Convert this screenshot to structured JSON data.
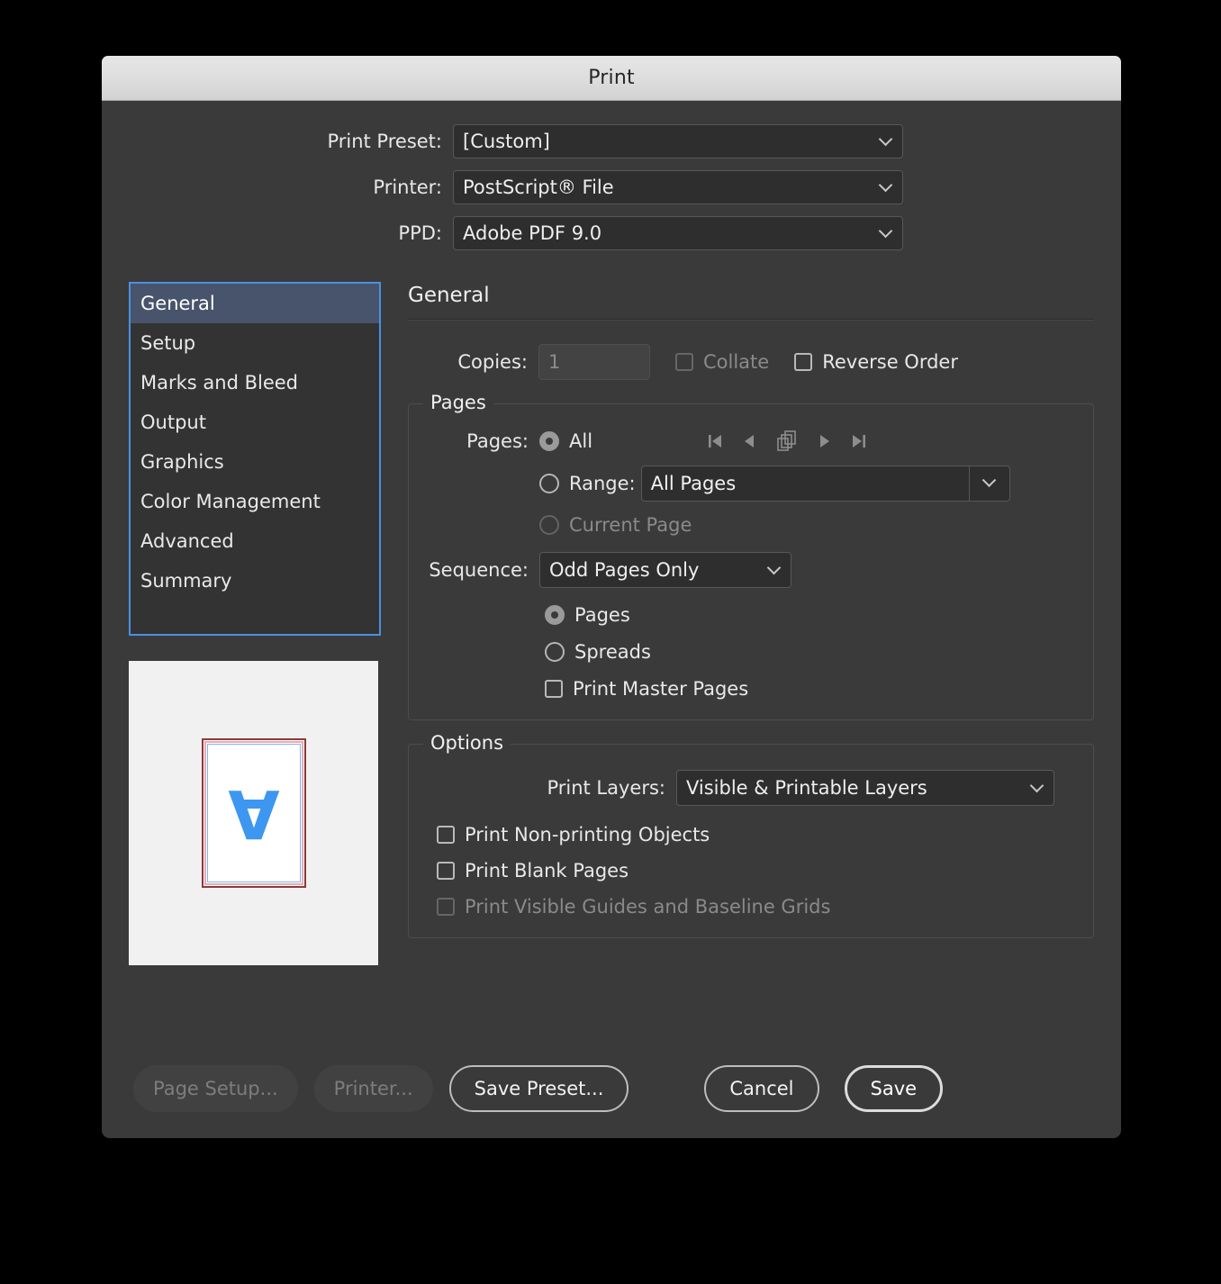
{
  "window": {
    "title": "Print"
  },
  "top_fields": [
    {
      "label": "Print Preset:",
      "value": "[Custom]",
      "name": "print-preset"
    },
    {
      "label": "Printer:",
      "value": "PostScript® File",
      "name": "printer"
    },
    {
      "label": "PPD:",
      "value": "Adobe PDF 9.0",
      "name": "ppd"
    }
  ],
  "sidebar": {
    "items": [
      {
        "label": "General",
        "selected": true
      },
      {
        "label": "Setup",
        "selected": false
      },
      {
        "label": "Marks and Bleed",
        "selected": false
      },
      {
        "label": "Output",
        "selected": false
      },
      {
        "label": "Graphics",
        "selected": false
      },
      {
        "label": "Color Management",
        "selected": false
      },
      {
        "label": "Advanced",
        "selected": false
      },
      {
        "label": "Summary",
        "selected": false
      }
    ]
  },
  "preview": {
    "glyph": "A",
    "page_color": "#ffffff",
    "bleed_color": "#f0a8b0",
    "trim_color": "#8b3a3a",
    "margin_color": "#7ab8f5",
    "art_color": "#3d97f0",
    "background_color": "#f1f1f1"
  },
  "main": {
    "section_title": "General",
    "copies": {
      "label": "Copies:",
      "value": "1",
      "collate_label": "Collate",
      "collate_checked": false,
      "reverse_order_label": "Reverse Order",
      "reverse_order_checked": false
    },
    "pages_group": {
      "legend": "Pages",
      "pages_label": "Pages:",
      "all_label": "All",
      "all_selected": true,
      "range_label": "Range:",
      "range_value": "All Pages",
      "range_selected": false,
      "current_page_label": "Current Page",
      "current_page_selected": false,
      "sequence_label": "Sequence:",
      "sequence_value": "Odd Pages Only",
      "pages_radio_label": "Pages",
      "pages_radio_selected": true,
      "spreads_label": "Spreads",
      "spreads_selected": false,
      "print_master_pages_label": "Print Master Pages",
      "print_master_pages_checked": false,
      "nav_icons": [
        "first-page-icon",
        "previous-page-icon",
        "pages-stack-icon",
        "next-page-icon",
        "last-page-icon"
      ]
    },
    "options_group": {
      "legend": "Options",
      "print_layers_label": "Print Layers:",
      "print_layers_value": "Visible & Printable Layers",
      "print_non_printing_label": "Print Non-printing Objects",
      "print_non_printing_checked": false,
      "print_blank_pages_label": "Print Blank Pages",
      "print_blank_pages_checked": false,
      "print_guides_label": "Print Visible Guides and Baseline Grids",
      "print_guides_checked": false
    }
  },
  "footer": {
    "page_setup": "Page Setup...",
    "printer": "Printer...",
    "save_preset": "Save Preset...",
    "cancel": "Cancel",
    "save": "Save"
  },
  "colors": {
    "accent_focus": "#4a90e2",
    "selection": "#47546b",
    "dialog_bg": "#3a3a3a",
    "titlebar": "#dedede"
  }
}
